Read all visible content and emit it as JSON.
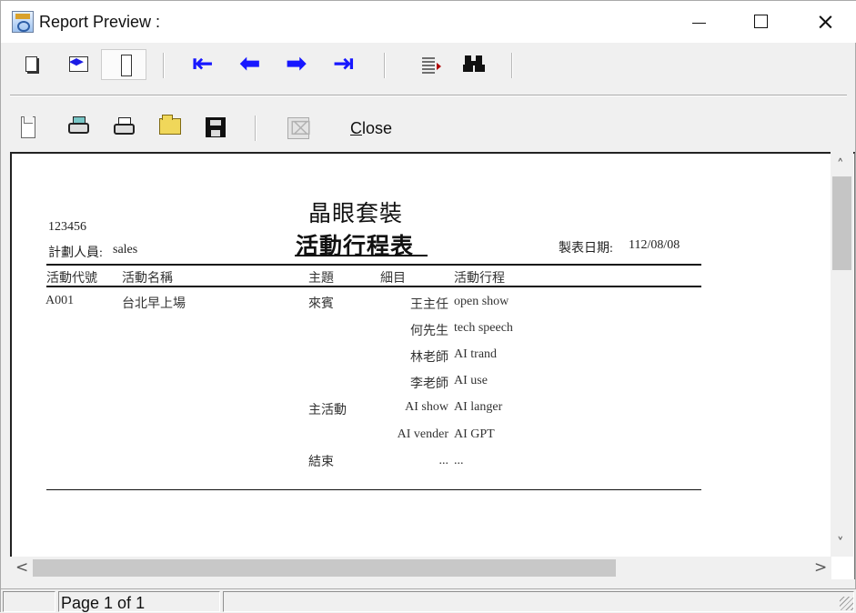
{
  "window": {
    "title": "Report Preview :",
    "controls": {
      "minimize": "minimize-icon",
      "maximize": "maximize-icon",
      "close": "close-icon"
    }
  },
  "toolbar1": {
    "items": [
      {
        "name": "small-page-icon"
      },
      {
        "name": "page-width-icon"
      },
      {
        "name": "full-page-icon"
      },
      {
        "name": "first-page-icon",
        "glyph": "⇤"
      },
      {
        "name": "previous-page-icon",
        "glyph": "⬅"
      },
      {
        "name": "next-page-icon",
        "glyph": "➡"
      },
      {
        "name": "last-page-icon",
        "glyph": "⇥"
      },
      {
        "name": "go-to-page-icon"
      },
      {
        "name": "find-icon",
        "glyph": "⛓"
      }
    ]
  },
  "toolbar2": {
    "items": [
      {
        "name": "document-icon"
      },
      {
        "name": "print-setup-icon"
      },
      {
        "name": "print-icon"
      },
      {
        "name": "open-icon"
      },
      {
        "name": "save-icon"
      },
      {
        "name": "disabled-export-icon"
      }
    ],
    "close_label_prefix": "C",
    "close_label_rest": "lose"
  },
  "report": {
    "header_left": {
      "code": "123456",
      "planner_label": "計劃人員:",
      "planner_value": "sales"
    },
    "title": "晶眼套裝",
    "subtitle": "活動行程表",
    "date_label": "製表日期:",
    "date_value": "112/08/08",
    "columns": [
      "活動代號",
      "活動名稱",
      "主題",
      "細目",
      "活動行程"
    ],
    "rows": [
      {
        "activity_code": "A001",
        "activity_name": "台北早上場",
        "topic": "來賓",
        "detail": "王主任",
        "schedule": "open show"
      },
      {
        "activity_code": "",
        "activity_name": "",
        "topic": "",
        "detail": "何先生",
        "schedule": "tech speech"
      },
      {
        "activity_code": "",
        "activity_name": "",
        "topic": "",
        "detail": "林老師",
        "schedule": "AI trand"
      },
      {
        "activity_code": "",
        "activity_name": "",
        "topic": "",
        "detail": "李老師",
        "schedule": "AI use"
      },
      {
        "activity_code": "",
        "activity_name": "",
        "topic": "主活動",
        "detail": "AI show",
        "schedule": "AI langer"
      },
      {
        "activity_code": "",
        "activity_name": "",
        "topic": "",
        "detail": "AI vender",
        "schedule": "AI GPT"
      },
      {
        "activity_code": "",
        "activity_name": "",
        "topic": "結束",
        "detail": "...",
        "schedule": "..."
      }
    ]
  },
  "status": {
    "page": "Page 1 of 1"
  },
  "scrollbars": {
    "vertical_up": "˄",
    "vertical_down": "˅",
    "horizontal_left": "<",
    "horizontal_right": ">"
  },
  "colors": {
    "navigation_arrow": "#1717ff",
    "window_background": "#f0f0f0",
    "report_background": "#ffffff"
  }
}
